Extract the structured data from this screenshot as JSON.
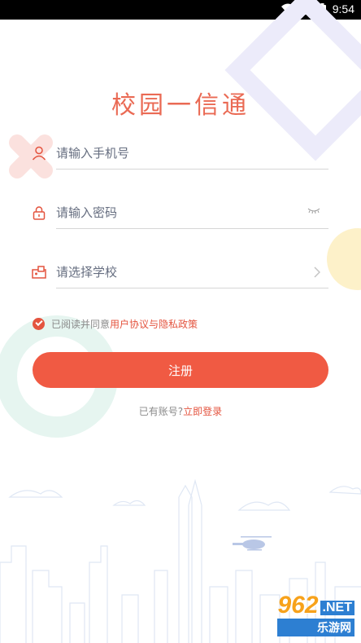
{
  "status_bar": {
    "time": "9:54",
    "icons": [
      "wifi-icon",
      "signal-icon",
      "battery-icon"
    ]
  },
  "app": {
    "title": "校园一信通"
  },
  "form": {
    "phone_placeholder": "请输入手机号",
    "password_placeholder": "请输入密码",
    "school_placeholder": "请选择学校"
  },
  "agreement": {
    "prefix": "已阅读并同意",
    "link": "用户协议与隐私政策",
    "checked": true
  },
  "register_button": "注册",
  "login_prompt": {
    "prefix": "已有账号?",
    "link": "立即登录"
  },
  "watermark": {
    "main": "962",
    "suffix": ".NET",
    "subtitle": "乐游网"
  },
  "colors": {
    "accent": "#f05a43",
    "title": "#ea6a54",
    "text_muted": "#8a8a8a"
  }
}
